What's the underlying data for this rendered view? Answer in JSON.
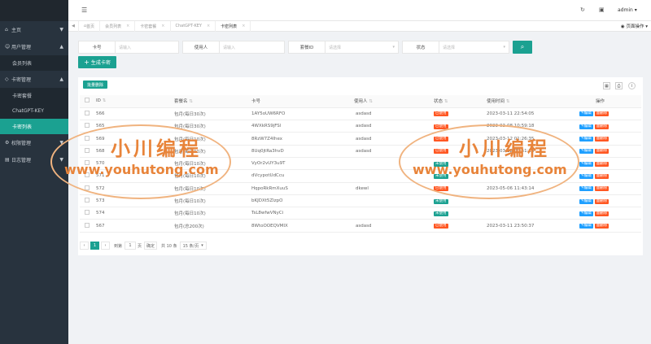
{
  "sidebar": {
    "home": "主页",
    "user_mgmt": "用户管理",
    "member_list": "会员列表",
    "card_mgmt": "卡密管理",
    "card_package": "卡密套餐",
    "chatgpt_key": "ChatGPT-KEY",
    "card_list": "卡密列表",
    "permission_mgmt": "权限管理",
    "log_mgmt": "日志管理"
  },
  "topbar": {
    "user": "admin"
  },
  "tabs": [
    {
      "label": "首页"
    },
    {
      "label": "会员列表"
    },
    {
      "label": "卡密套餐"
    },
    {
      "label": "ChatGPT-KEY"
    },
    {
      "label": "卡密列表"
    }
  ],
  "page_ops": "页面操作",
  "search": {
    "card_label": "卡号",
    "card_placeholder": "请输入",
    "user_label": "使用人",
    "user_placeholder": "请输入",
    "package_label": "套餐ID",
    "package_placeholder": "请选择",
    "status_label": "状态",
    "status_placeholder": "请选择"
  },
  "generate_button": "生成卡密",
  "batch_delete": "批量删除",
  "table": {
    "headers": [
      "ID",
      "套餐名",
      "卡号",
      "使用人",
      "状态",
      "使用时间",
      "操作"
    ],
    "rows": [
      {
        "id": "566",
        "package": "包月(每日30次)",
        "card": "1AY5oUW6RFO",
        "user": "asdasd",
        "status": "已使用",
        "time": "2023-03-11 22:54:05",
        "used": true
      },
      {
        "id": "565",
        "package": "包月(每日30次)",
        "card": "4WXkRS9jFSl",
        "user": "asdasd",
        "status": "已使用",
        "time": "2023-03-08 10:59:18",
        "used": true
      },
      {
        "id": "569",
        "package": "包月(每日10次)",
        "card": "8RzW7Z4Ihex",
        "user": "asdasd",
        "status": "已使用",
        "time": "2023-03-12 01:26:35",
        "used": true
      },
      {
        "id": "568",
        "package": "包月(每日10次)",
        "card": "8Uq0jtRa3hvD",
        "user": "asdasd",
        "status": "已使用",
        "time": "2023-03-12 00:51:28",
        "used": true
      },
      {
        "id": "570",
        "package": "包月(每日10次)",
        "card": "VyOr2vUY3u9T",
        "user": "",
        "status": "未使用",
        "time": "",
        "used": false
      },
      {
        "id": "571",
        "package": "包月(每日10次)",
        "card": "dVcypotUdCcu",
        "user": "",
        "status": "未使用",
        "time": "",
        "used": false
      },
      {
        "id": "572",
        "package": "包月(每日10次)",
        "card": "HqpoRkRmXuuS",
        "user": "dkewl",
        "status": "已使用",
        "time": "2023-05-06 11:43:14",
        "used": true
      },
      {
        "id": "573",
        "package": "包月(每日10次)",
        "card": "bKJDXt5ZIzpO",
        "user": "",
        "status": "未使用",
        "time": "",
        "used": false
      },
      {
        "id": "574",
        "package": "包月(每日10次)",
        "card": "TsL8wfwVNyCi",
        "user": "",
        "status": "未使用",
        "time": "",
        "used": false
      },
      {
        "id": "567",
        "package": "包月(总200次)",
        "card": "8WtoOOEQVMIX",
        "user": "asdasd",
        "status": "已使用",
        "time": "2023-03-11 23:50:37",
        "used": true
      }
    ],
    "edit_label": "编辑",
    "delete_label": "删除"
  },
  "pager": {
    "current": "1",
    "goto_label": "到第",
    "goto_value": "1",
    "page_unit": "页",
    "confirm": "确定",
    "total": "共 10 条",
    "per_page": "15 条/页"
  },
  "watermark": {
    "cn": "小川编程",
    "en": "www.youhutong.com"
  },
  "colors": {
    "sidebar": "#28333e",
    "accent": "#1ba191",
    "danger": "#ff5722",
    "edit": "#1e9fff"
  }
}
